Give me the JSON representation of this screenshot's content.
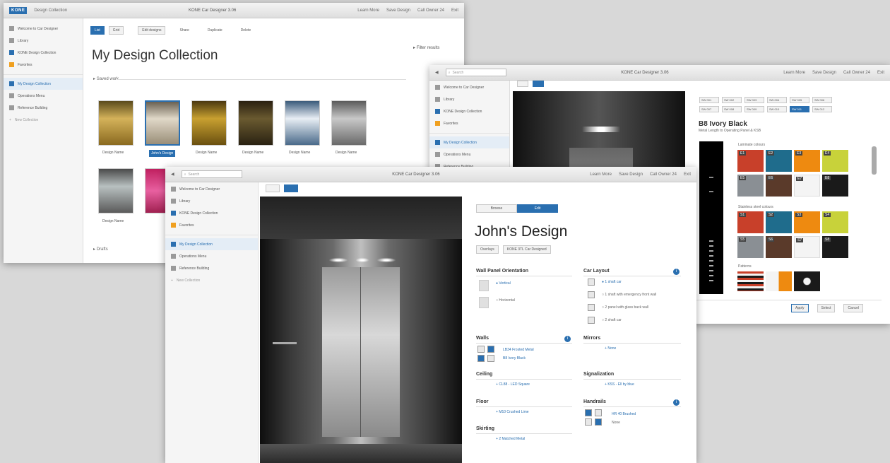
{
  "win1": {
    "logo": "KONE",
    "app_title": "Design Collection",
    "center_title": "KONE Car Designer 3.06",
    "nav": [
      "Learn More",
      "Save Design",
      "Call Owner 24",
      "Exit"
    ],
    "sidebar": [
      "Welcome to Car Designer",
      "Library",
      "KONE Design Collection",
      "Favorites",
      "My Design Collection",
      "Operations Menu",
      "Reference Building",
      "New Collection"
    ],
    "toolbar": {
      "view_a": "List",
      "view_b": "Grid",
      "edit_designs": "Edit designs",
      "share": "Share",
      "duplicate": "Duplicate",
      "delete": "Delete"
    },
    "page_title": "My Design Collection",
    "section_recent": "Saved work",
    "section_drafts": "Drafts",
    "filter_title": "Filter results",
    "selected_caption": "John's Design",
    "captions": [
      "Design Name",
      "Design Name",
      "Design Name",
      "Design Name",
      "Design Name",
      "Design Name",
      "Design Name",
      "Design Name"
    ]
  },
  "win2": {
    "search": "Search",
    "center_title": "KONE Car Designer 3.06",
    "nav": [
      "Learn More",
      "Save Design",
      "Call Owner 24",
      "Exit"
    ],
    "sidebar": [
      "Welcome to Car Designer",
      "Library",
      "KONE Design Collection",
      "Favorites",
      "My Design Collection",
      "Operations Menu",
      "Reference Building"
    ],
    "tab_labels": [
      "SW 001",
      "SW 002",
      "SW 003",
      "SW 004",
      "SW 005",
      "SW 006",
      "SW 007",
      "SW 008",
      "SW 009",
      "SW 010",
      "SW 011",
      "SW 012"
    ],
    "panel_title": "B8 Ivory Black",
    "panel_sub": "Metal Length to Operating Panel & KSB",
    "group_a": "Laminate colours",
    "group_b": "Stainless steel colours",
    "group_c": "Patterns",
    "chips": [
      "E1",
      "E2",
      "E3",
      "E4",
      "E5",
      "E6",
      "E7",
      "E8",
      "S1",
      "S2",
      "S3",
      "S4",
      "S5",
      "S6",
      "S7",
      "S8"
    ],
    "buttons": [
      "Apply",
      "Select",
      "Cancel"
    ]
  },
  "win3": {
    "search": "Search",
    "center_title": "KONE Car Designer 3.06",
    "nav": [
      "Learn More",
      "Save Design",
      "Call Owner 24",
      "Exit"
    ],
    "sidebar": [
      "Welcome to Car Designer",
      "Library",
      "KONE Design Collection",
      "Favorites",
      "My Design Collection",
      "Operations Menu",
      "Reference Building",
      "New Collection"
    ],
    "tabs": [
      "Browse",
      "Edit"
    ],
    "design_title": "John's Design",
    "tags": [
      "Overlays",
      "KONE 3TL Car Designed"
    ],
    "wall_orientation": "Wall Panel Orientation",
    "orient_options": [
      "Vertical",
      "Horizontal"
    ],
    "car_layout": "Car Layout",
    "layout_options": [
      "1 shaft car",
      "1 shaft with emergency front wall",
      "2 panel with glass back wall",
      "2 shaft car"
    ],
    "walls": "Walls",
    "walls_items": [
      "LB34 Frosted Metal",
      "B8 Ivory Black"
    ],
    "mirrors": "Mirrors",
    "mirrors_item": "None",
    "ceiling": "Ceiling",
    "ceiling_item": "CL88 - LED Square",
    "signalization": "Signalization",
    "signal_item": "KSS - Ell by blue",
    "floor": "Floor",
    "floor_item": "M10 Crushed Lime",
    "handrails": "Handrails",
    "handrail_items": [
      "HR 40 Brushed",
      "None"
    ],
    "skirting": "Skirting",
    "skirting_item": "2 Matched Metal"
  },
  "colors": {
    "accent": "#2a6fb0",
    "swatch_red": "#c8402a",
    "swatch_blue": "#1f6c8c",
    "swatch_orange": "#ee8a10",
    "swatch_lime": "#c8d23a",
    "swatch_grey": "#8a8f94",
    "swatch_brown": "#5a3a2a",
    "swatch_white": "#f4f4f4",
    "swatch_black": "#1a1a1a"
  }
}
